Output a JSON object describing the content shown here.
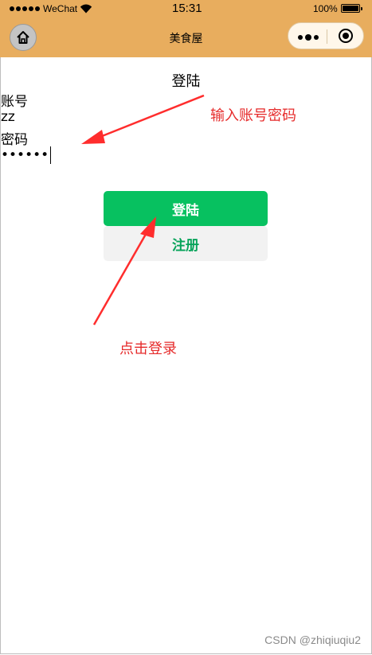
{
  "status_bar": {
    "carrier": "WeChat",
    "time": "15:31",
    "battery": "100%"
  },
  "nav_bar": {
    "title": "美食屋"
  },
  "form": {
    "heading": "登陆",
    "account_label": "账号",
    "account_value": "zz",
    "password_label": "密码",
    "password_value": "••••••"
  },
  "buttons": {
    "login": "登陆",
    "register": "注册"
  },
  "annotations": {
    "input_hint": "输入账号密码",
    "click_hint": "点击登录"
  },
  "watermark": "CSDN @zhiqiuqiu2",
  "colors": {
    "nav_bar": "#e8ad5e",
    "primary_button": "#07c160",
    "secondary_button": "#f2f2f2",
    "annotation": "#e62b2b"
  }
}
